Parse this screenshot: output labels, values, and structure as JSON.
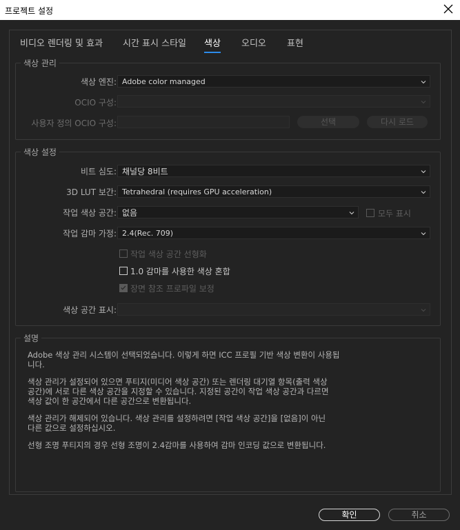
{
  "window": {
    "title": "프로젝트 설정"
  },
  "tabs": [
    {
      "label": "비디오 렌더링 및 효과"
    },
    {
      "label": "시간 표시 스타일"
    },
    {
      "label": "색상"
    },
    {
      "label": "오디오"
    },
    {
      "label": "표현"
    }
  ],
  "color_management": {
    "title": "색상 관리",
    "engine_label": "색상 엔진:",
    "engine_value": "Adobe color managed",
    "ocio_config_label": "OCIO 구성:",
    "ocio_config_value": "",
    "custom_ocio_label": "사용자 정의 OCIO 구성:",
    "custom_ocio_value": "",
    "select_button": "선택",
    "reload_button": "다시 로드"
  },
  "color_settings": {
    "title": "색상 설정",
    "bit_depth_label": "비트 심도:",
    "bit_depth_value": "채널당 8비트",
    "lut_label": "3D LUT 보간:",
    "lut_value": "Tetrahedral (requires GPU acceleration)",
    "working_space_label": "작업 색상 공간:",
    "working_space_value": "없음",
    "show_all_label": "모두 표시",
    "gamma_label": "작업 감마 가정:",
    "gamma_value": "2.4(Rec. 709)",
    "linearize_label": "작업 색상 공간 선형화",
    "blend_gamma_label": "1.0 감마를 사용한 색상 혼합",
    "scene_referred_label": "장면 참조 프로파일 보정",
    "display_space_label": "색상 공간 표시:",
    "display_space_value": ""
  },
  "description": {
    "title": "설명",
    "p1_line1": "Adobe 색상 관리 시스템이 선택되었습니다. 이렇게 하면 ICC 프로필 기반 색상 변환이 사용됩",
    "p1_line2": "니다.",
    "p2_line1": "색상 관리가 설정되어 있으면 푸티지(미디어 색상 공간) 또는 렌더링 대기열 항목(출력 색상",
    "p2_line2": "공간)에 서로 다른 색상 공간을 지정할 수 있습니다. 지정된 공간이 작업 색상 공간과 다르면",
    "p2_line3": "색상 값이 한 공간에서 다른 공간으로 변환됩니다.",
    "p3_line1": "색상 관리가 해제되어 있습니다. 색상 관리를 설정하려면 [작업 색상 공간]을 [없음]이 아닌",
    "p3_line2": "다른 값으로 설정하십시오.",
    "p4_line1": "선형 조명 푸티지의 경우 선형 조명이 2.4감마를 사용하여 감마 인코딩 값으로 변환됩니다."
  },
  "footer": {
    "ok_label": "확인",
    "cancel_label": "취소"
  }
}
